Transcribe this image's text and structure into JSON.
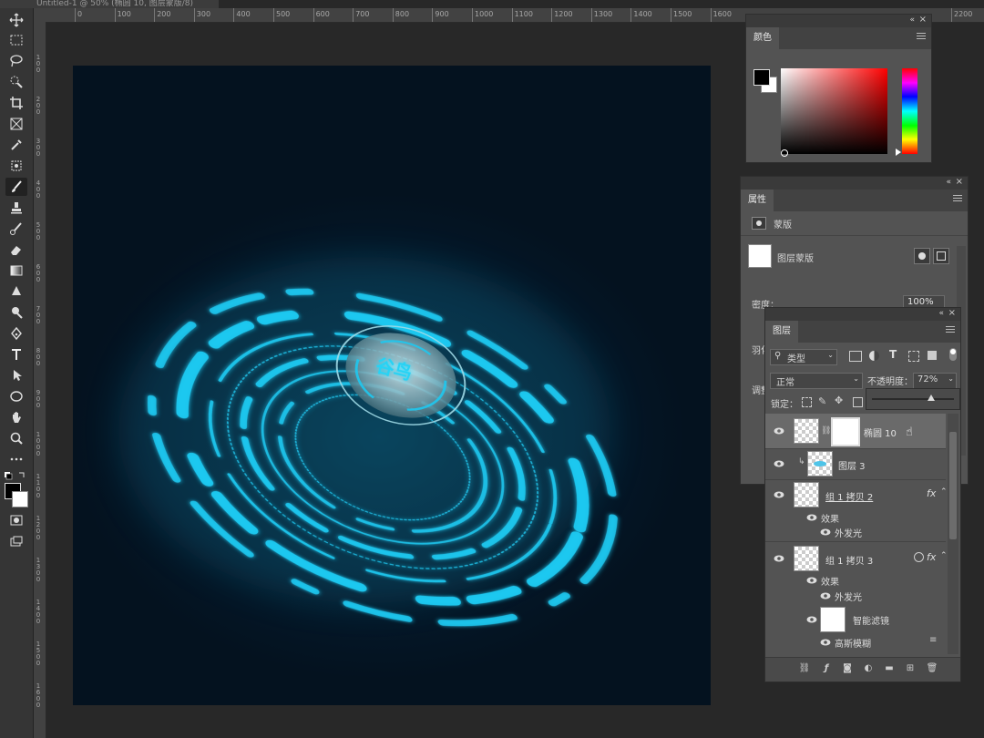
{
  "document_tab": {
    "title": "Untitled-1 @ 50% (椭圆 10, 图层蒙版/8)"
  },
  "ruler": {
    "top_labels": [
      "0",
      "100",
      "200",
      "300",
      "400",
      "500",
      "600",
      "700",
      "800",
      "900",
      "1000",
      "1100",
      "1200",
      "1300",
      "1400",
      "1500",
      "1600",
      "2200"
    ],
    "left_labels": [
      "100",
      "200",
      "300",
      "400",
      "500",
      "600",
      "700",
      "800",
      "900",
      "1000",
      "1100",
      "1200",
      "1300",
      "1400",
      "1500",
      "1600"
    ]
  },
  "canvas": {
    "logo_text": "谷鸟",
    "accent": "#19c6f0",
    "bg": "#05182a"
  },
  "color_panel": {
    "tab": "颜色",
    "fg": "#000000",
    "bg": "#ffffff",
    "hue": "#ff0000"
  },
  "properties_panel": {
    "tab": "属性",
    "mask_type": "蒙版",
    "layer_mask_label": "图层蒙版",
    "density_label": "密度：",
    "density_value": "100%",
    "feather_label": "羽化",
    "adjust_label": "调整"
  },
  "layers_panel": {
    "tab": "图层",
    "filter_kind": "类型",
    "blend_mode": "正常",
    "opacity_label": "不透明度：",
    "opacity_value": "72%",
    "opacity_fraction": 0.72,
    "lock_label": "锁定：",
    "layers": [
      {
        "name": "椭圆 10",
        "selected": true
      },
      {
        "name": "图层 3",
        "clipped": true
      },
      {
        "name": "组 1 拷贝 2",
        "fx": "fx",
        "effects_label": "效果",
        "effect": "外发光"
      },
      {
        "name": "组 1 拷贝 3",
        "fx": "fx",
        "effects_label": "效果",
        "effect": "外发光",
        "smart_filter": "智能滤镜",
        "filter": "高斯模糊"
      }
    ]
  }
}
